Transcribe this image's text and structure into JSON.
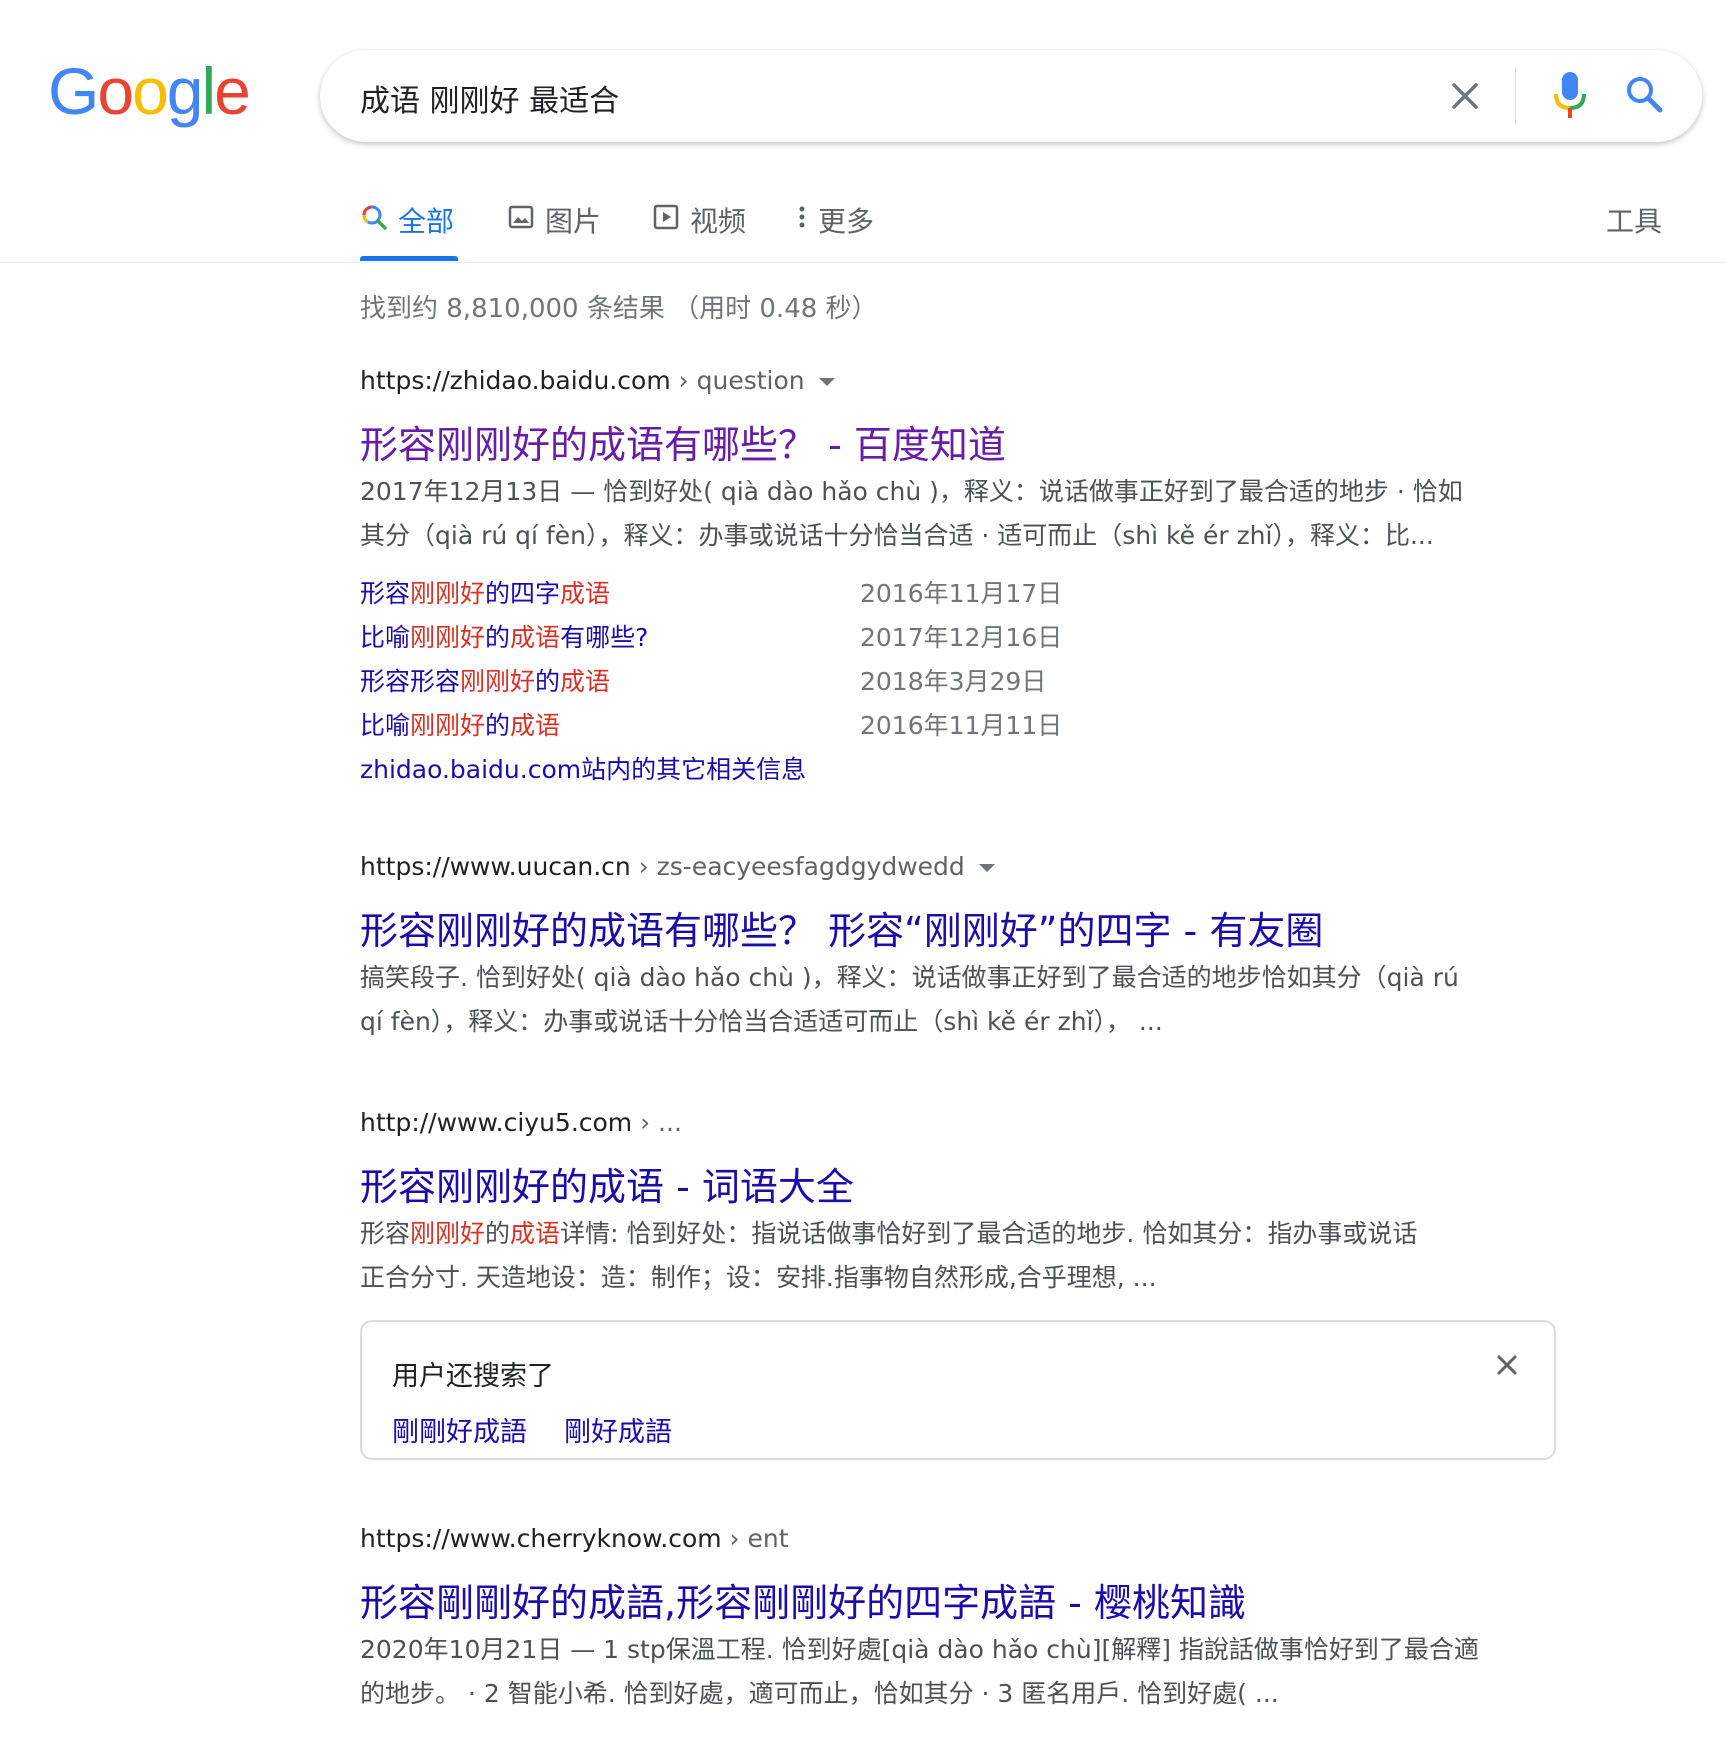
{
  "logo": {
    "letters": [
      "G",
      "o",
      "o",
      "g",
      "l",
      "e"
    ],
    "colors": [
      "#4285f4",
      "#ea4335",
      "#fbbc05",
      "#4285f4",
      "#34a853",
      "#ea4335"
    ]
  },
  "search": {
    "query": "成语 刚刚好 最适合"
  },
  "tabs": [
    {
      "label": "全部",
      "icon": "search-icon"
    },
    {
      "label": "图片",
      "icon": "image-icon"
    },
    {
      "label": "视频",
      "icon": "video-icon"
    },
    {
      "label": "更多",
      "icon": "more-vert-icon"
    }
  ],
  "tools_label": "工具",
  "stats": "找到约 8,810,000 条结果 （用时 0.48 秒）",
  "results": [
    {
      "url": "https://zhidao.baidu.com",
      "path": " › question",
      "title": "形容刚刚好的成语有哪些？ - 百度知道",
      "snippet_line1": "2017年12月13日 — 恰到好处( qià dào hǎo chù )，释义：说话做事正好到了最合适的地步 · 恰如",
      "snippet_line2": "其分（qià rú qí fèn），释义：办事或说话十分恰当合适 · 适可而止（shì kě ér zhǐ），释义：比...",
      "sublinks": [
        {
          "parts": [
            "形容",
            "刚刚好",
            "的四字",
            "成语"
          ],
          "date": "2016年11月17日"
        },
        {
          "parts": [
            "比喻",
            "刚刚好",
            "的",
            "成语",
            "有哪些?"
          ],
          "date": "2017年12月16日"
        },
        {
          "parts": [
            "形容形容",
            "刚刚好",
            "的",
            "成语"
          ],
          "date": "2018年3月29日"
        },
        {
          "parts": [
            "比喻",
            "刚刚好",
            "的",
            "成语"
          ],
          "date": "2016年11月11日"
        }
      ],
      "more_link": "zhidao.baidu.com站内的其它相关信息"
    },
    {
      "url": "https://www.uucan.cn",
      "path": " › zs-eacyeesfagdgydwedd",
      "title": "形容刚刚好的成语有哪些？ 形容“刚刚好”的四字 - 有友圈",
      "snippet_line1": "搞笑段子. 恰到好处( qià dào hǎo chù )，释义：说话做事正好到了最合适的地步恰如其分（qià rú",
      "snippet_line2": "qí fèn），释义：办事或说话十分恰当合适适可而止（shì kě ér zhǐ），  ..."
    },
    {
      "url": "http://www.ciyu5.com",
      "path": " › ...",
      "title": "形容刚刚好的成语 - 词语大全",
      "snippet_parts": [
        "形容",
        "刚刚好",
        "的",
        "成语",
        "详情: 恰到好处：指说话做事恰好到了最合适的地步. 恰如其分：指办事或说话"
      ],
      "snippet_line2": "正合分寸. 天造地设：造：制作；设：安排.指事物自然形成,合乎理想, ..."
    },
    {
      "url": "https://www.cherryknow.com",
      "path": " › ent",
      "title": "形容剛剛好的成語,形容剛剛好的四字成語 - 樱桃知識",
      "snippet_line1": "2020年10月21日 — 1 stp保溫工程. 恰到好處[qià dào hǎo chù][解釋] 指說話做事恰好到了最合適",
      "snippet_line2": "的地步。 · 2 智能小希. 恰到好處，適可而止，恰如其分 · 3 匿名用戶. 恰到好處( ..."
    }
  ],
  "related": {
    "title": "用户还搜索了",
    "links": [
      "剛剛好成語",
      "剛好成語"
    ]
  }
}
